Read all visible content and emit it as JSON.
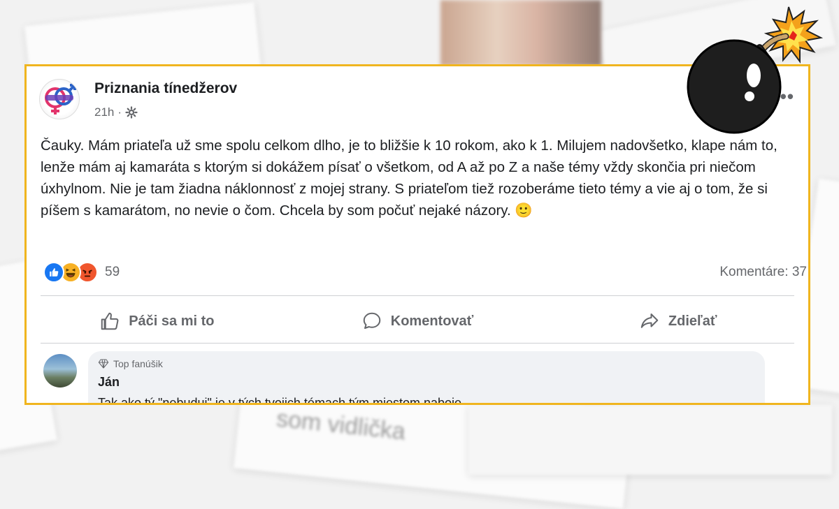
{
  "background": {
    "faint_text": "som vidlička"
  },
  "post": {
    "page_name": "Priznania tínedžerov",
    "time": "21h",
    "privacy_icon": "gear-icon",
    "more_label": "•••",
    "text": "Čauky. Mám priateľa už sme spolu celkom dlho, je to bližšie k 10 rokom, ako k 1. Milujem nadovšetko, klape nám to, lenže mám aj kamaráta s ktorým si dokážem písať o všetkom, od A až po Z a naše témy vždy skončia pri niečom úxhylnom. Nie je tam žiadna náklonnosť z mojej strany. S priateľom tiež rozoberáme tieto témy a vie aj o tom, že si píšem s kamarátom, no nevie o čom. Chcela by som počuť nejaké názory. 🙂",
    "reactions": {
      "icons": [
        "like-icon",
        "haha-icon",
        "angry-icon"
      ],
      "count": "59"
    },
    "comments_count": "Komentáre: 37",
    "actions": {
      "like": "Páči sa mi to",
      "comment": "Komentovať",
      "share": "Zdieľať"
    }
  },
  "comment": {
    "badge": "Top fanúšik",
    "name": "Ján",
    "text_cut": "Tak ako tý \"nebuduj\" je v tých tvojich témach tým miestom naboje ..."
  },
  "colors": {
    "frame": "#f0b51f",
    "like_blue": "#1877f2",
    "angry": "#f0562d",
    "haha": "#f7b125"
  }
}
